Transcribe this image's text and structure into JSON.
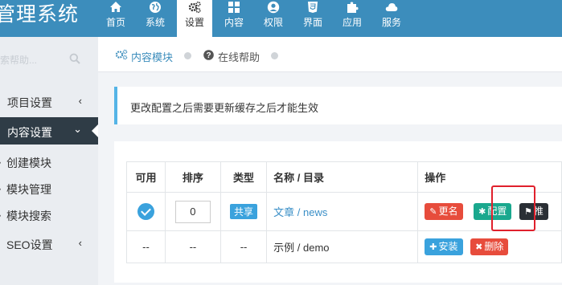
{
  "app": {
    "title": "管理系统"
  },
  "topnav": {
    "items": [
      {
        "label": "首页",
        "icon": "home-icon"
      },
      {
        "label": "系统",
        "icon": "globe-icon"
      },
      {
        "label": "设置",
        "icon": "cogs-icon",
        "active": true
      },
      {
        "label": "内容",
        "icon": "grid-icon"
      },
      {
        "label": "权限",
        "icon": "user-icon"
      },
      {
        "label": "界面",
        "icon": "html5-icon"
      },
      {
        "label": "应用",
        "icon": "puzzle-icon"
      },
      {
        "label": "服务",
        "icon": "cloud-icon"
      }
    ]
  },
  "sidebar": {
    "search_placeholder": "索帮助...",
    "items": [
      {
        "label": "项目设置",
        "chevron": "‹"
      },
      {
        "label": "内容设置",
        "chevron": "⌄",
        "active": true
      },
      {
        "label": "SEO设置",
        "chevron": "‹"
      }
    ],
    "subitems": [
      {
        "label": "创建模块"
      },
      {
        "label": "模块管理"
      },
      {
        "label": "模块搜索"
      }
    ]
  },
  "breadcrumb": {
    "items": [
      "内容模块",
      "在线帮助"
    ]
  },
  "notice": {
    "text": "更改配置之后需要更新缓存之后才能生效"
  },
  "table": {
    "headers": [
      "可用",
      "排序",
      "类型",
      "名称 / 目录",
      "操作"
    ],
    "rows": [
      {
        "enabled": true,
        "order": "0",
        "type": "共享",
        "name": "文章 / news",
        "actions": [
          "更名",
          "配置",
          "推"
        ]
      },
      {
        "enabled": "--",
        "order": "--",
        "type": "--",
        "name": "示例 / demo",
        "actions": [
          "安装",
          "删除"
        ]
      }
    ]
  },
  "colors": {
    "topbar": "#3c8dbc",
    "sidebar_active": "#2f3c46",
    "accent": "#3aa2dd",
    "highlight": "#e0202c"
  }
}
